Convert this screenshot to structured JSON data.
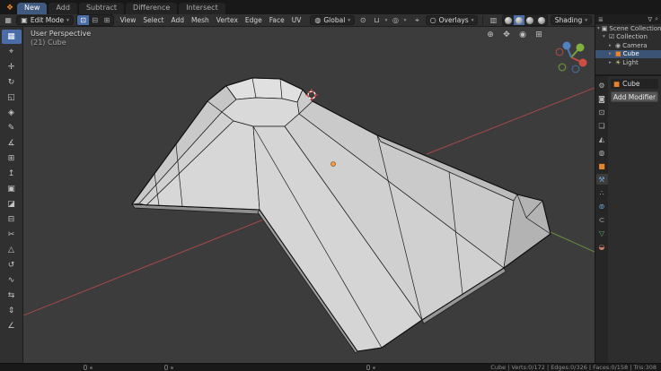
{
  "colors": {
    "accent": "#4a6da8",
    "selection_orange": "#e8832c",
    "axis_x": "#b04a4a",
    "axis_y": "#6c9a3c",
    "viewport_bg": "#3c3c3c"
  },
  "topbar": {
    "app_icon_glyph": "❖",
    "tabs": [
      {
        "label": "New",
        "active": true
      },
      {
        "label": "Add",
        "active": false
      },
      {
        "label": "Subtract",
        "active": false
      },
      {
        "label": "Difference",
        "active": false
      },
      {
        "label": "Intersect",
        "active": false
      }
    ]
  },
  "header": {
    "editor_icon": "▦",
    "mode_icon": "▣",
    "mode_label": "Edit Mode",
    "select_modes": [
      {
        "name": "vertex-select",
        "glyph": "⊡",
        "active": true
      },
      {
        "name": "edge-select",
        "glyph": "⊟",
        "active": false
      },
      {
        "name": "face-select",
        "glyph": "⊞",
        "active": false
      }
    ],
    "menus": [
      "View",
      "Select",
      "Add",
      "Mesh",
      "Vertex",
      "Edge",
      "Face",
      "UV"
    ],
    "orientation_icon": "◍",
    "orientation_label": "Global",
    "pivot_icon": "⊙",
    "snap_icon": "⊔",
    "proportional_icon": "◎",
    "gizmo_icon": "⌖",
    "overlays_icon": "○",
    "overlays_label": "Overlays",
    "xray_icon": "▥",
    "shading_modes": [
      {
        "name": "wireframe",
        "active": false
      },
      {
        "name": "solid",
        "active": true
      },
      {
        "name": "material-preview",
        "active": false
      },
      {
        "name": "rendered",
        "active": false
      }
    ],
    "shading_label": "Shading"
  },
  "tools": {
    "items": [
      {
        "name": "select-box",
        "glyph": "▦",
        "active": true
      },
      {
        "name": "cursor",
        "glyph": "⌖",
        "active": false
      },
      {
        "name": "move",
        "glyph": "✛",
        "active": false
      },
      {
        "name": "rotate",
        "glyph": "↻",
        "active": false
      },
      {
        "name": "scale",
        "glyph": "◱",
        "active": false
      },
      {
        "name": "transform",
        "glyph": "◈",
        "active": false
      },
      {
        "name": "annotate",
        "glyph": "✎",
        "active": false
      },
      {
        "name": "measure",
        "glyph": "∡",
        "active": false
      },
      {
        "name": "add-cube",
        "glyph": "⊞",
        "active": false
      },
      {
        "name": "extrude-region",
        "glyph": "↥",
        "active": false
      },
      {
        "name": "inset-faces",
        "glyph": "▣",
        "active": false
      },
      {
        "name": "bevel",
        "glyph": "◪",
        "active": false
      },
      {
        "name": "loop-cut",
        "glyph": "⊟",
        "active": false
      },
      {
        "name": "knife",
        "glyph": "✂",
        "active": false
      },
      {
        "name": "poly-build",
        "glyph": "△",
        "active": false
      },
      {
        "name": "spin",
        "glyph": "↺",
        "active": false
      },
      {
        "name": "smooth",
        "glyph": "∿",
        "active": false
      },
      {
        "name": "edge-slide",
        "glyph": "⇆",
        "active": false
      },
      {
        "name": "shrink-fatten",
        "glyph": "⇕",
        "active": false
      },
      {
        "name": "shear",
        "glyph": "∠",
        "active": false
      }
    ]
  },
  "viewport": {
    "view_label": "User Perspective",
    "object_label": "(21) Cube",
    "nav_icons": [
      {
        "name": "zoom-view",
        "glyph": "⊕"
      },
      {
        "name": "move-view",
        "glyph": "✥"
      },
      {
        "name": "camera-view",
        "glyph": "◉"
      },
      {
        "name": "toggle-perspective",
        "glyph": "⊞"
      }
    ]
  },
  "outliner": {
    "editor_icon": "≣",
    "filter_icon": "∇",
    "search_icon": "⌕",
    "items": [
      {
        "label": "Scene Collection",
        "icon": "▣",
        "icon_color": "#c8c8c8",
        "caret": "▾",
        "indent": 0,
        "active": false
      },
      {
        "label": "Collection",
        "icon": "☑",
        "icon_color": "#c8c8c8",
        "caret": "▾",
        "indent": 1,
        "active": false
      },
      {
        "label": "Camera",
        "icon": "◉",
        "icon_color": "#b8b8b8",
        "caret": "▸",
        "indent": 2,
        "active": false
      },
      {
        "label": "Cube",
        "icon": "■",
        "icon_color": "#e8832c",
        "caret": "▸",
        "indent": 2,
        "active": true
      },
      {
        "label": "Light",
        "icon": "☀",
        "icon_color": "#ded874",
        "caret": "▸",
        "indent": 2,
        "active": false
      }
    ]
  },
  "properties": {
    "tabs": [
      {
        "name": "tool",
        "glyph": "⚙",
        "color": "#b5b5b5",
        "active": false
      },
      {
        "name": "render",
        "glyph": "◙",
        "color": "#b5b5b5",
        "active": false
      },
      {
        "name": "output",
        "glyph": "⊡",
        "color": "#b5b5b5",
        "active": false
      },
      {
        "name": "view-layer",
        "glyph": "❏",
        "color": "#b5b5b5",
        "active": false
      },
      {
        "name": "scene",
        "glyph": "◭",
        "color": "#b5b5b5",
        "active": false
      },
      {
        "name": "world",
        "glyph": "◍",
        "color": "#b5b5b5",
        "active": false
      },
      {
        "name": "object",
        "glyph": "■",
        "color": "#e8832c",
        "active": false
      },
      {
        "name": "modifiers",
        "glyph": "⚒",
        "color": "#6fa8dc",
        "active": true
      },
      {
        "name": "particles",
        "glyph": "∴",
        "color": "#b5b5b5",
        "active": false
      },
      {
        "name": "physics",
        "glyph": "⊚",
        "color": "#6fa8dc",
        "active": false
      },
      {
        "name": "constraints",
        "glyph": "⊂",
        "color": "#b5b5b5",
        "active": false
      },
      {
        "name": "object-data",
        "glyph": "▽",
        "color": "#58b368",
        "active": false
      },
      {
        "name": "material",
        "glyph": "◒",
        "color": "#cc7a66",
        "active": false
      }
    ],
    "breadcrumb": {
      "icon": "■",
      "label": "Cube"
    },
    "add_modifier_label": "Add Modifier"
  },
  "statusbar": {
    "stats": "Cube | Verts:0/172 | Edges:0/326 | Faces:0/158 | Tris:308"
  }
}
